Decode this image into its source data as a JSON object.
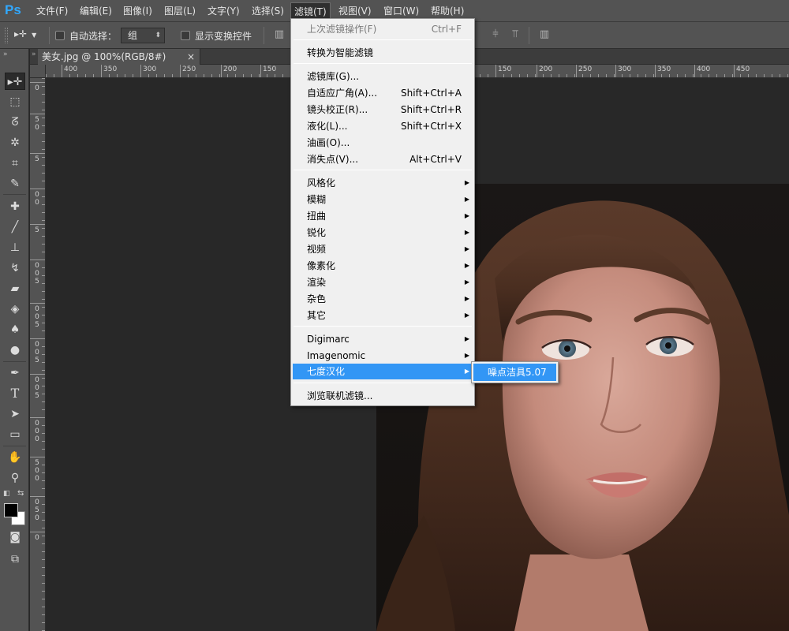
{
  "app": {
    "logo": "Ps"
  },
  "menubar": {
    "items": [
      "文件(F)",
      "编辑(E)",
      "图像(I)",
      "图层(L)",
      "文字(Y)",
      "选择(S)",
      "滤镜(T)",
      "视图(V)",
      "窗口(W)",
      "帮助(H)"
    ],
    "active": "滤镜(T)"
  },
  "options": {
    "auto_select_label": "自动选择：",
    "auto_select_checked": false,
    "group_select_value": "组",
    "show_transform_label": "显示变换控件",
    "show_transform_checked": false,
    "preset_icon": "move-tool-icon"
  },
  "document": {
    "tab_title": "美女.jpg @ 100%(RGB/8#)",
    "close_symbol": "×"
  },
  "ruler": {
    "h_labels": [
      "400",
      "350",
      "300",
      "250",
      "200",
      "150",
      "150",
      "200",
      "250",
      "300",
      "350",
      "400",
      "450"
    ],
    "v_labels": [
      "0",
      "5",
      "0",
      "5",
      "0",
      "0",
      "5",
      "0",
      "0",
      "5",
      "0",
      "0",
      "5",
      "0",
      "0",
      "5",
      "0",
      "0",
      "5",
      "0",
      "0",
      "0",
      "5",
      "0",
      "0",
      "0",
      "5",
      "0",
      "0"
    ]
  },
  "toolbar": {
    "tools": [
      "move-tool-icon",
      "marquee-tool-icon",
      "lasso-tool-icon",
      "magic-wand-icon",
      "crop-tool-icon",
      "eyedropper-icon",
      "healing-brush-icon",
      "brush-tool-icon",
      "clone-stamp-icon",
      "history-brush-icon",
      "eraser-icon",
      "paint-bucket-icon",
      "blur-tool-icon",
      "dodge-tool-icon",
      "pen-tool-icon",
      "type-tool-icon",
      "path-selection-icon",
      "shape-tool-icon",
      "hand-tool-icon",
      "zoom-tool-icon",
      "quick-mask-icon",
      "screen-mode-icon"
    ],
    "foreground_color": "#000000",
    "background_color": "#ffffff"
  },
  "filter_menu": {
    "last_filter": {
      "label": "上次滤镜操作(F)",
      "shortcut": "Ctrl+F",
      "disabled": true
    },
    "convert_smart": "转换为智能滤镜",
    "group2": [
      {
        "label": "滤镜库(G)...",
        "shortcut": ""
      },
      {
        "label": "自适应广角(A)...",
        "shortcut": "Shift+Ctrl+A"
      },
      {
        "label": "镜头校正(R)...",
        "shortcut": "Shift+Ctrl+R"
      },
      {
        "label": "液化(L)...",
        "shortcut": "Shift+Ctrl+X"
      },
      {
        "label": "油画(O)...",
        "shortcut": ""
      },
      {
        "label": "消失点(V)...",
        "shortcut": "Alt+Ctrl+V"
      }
    ],
    "group3": [
      "风格化",
      "模糊",
      "扭曲",
      "锐化",
      "视频",
      "像素化",
      "渲染",
      "杂色",
      "其它"
    ],
    "group4": [
      "Digimarc",
      "Imagenomic",
      "七度汉化"
    ],
    "highlighted": "七度汉化",
    "browse_online": "浏览联机滤镜...",
    "submenu_arrow": "▶"
  },
  "submenu": {
    "items": [
      "噪点洁具5.07"
    ]
  },
  "colors": {
    "menu_highlight": "#3296f5",
    "ui_panel": "#535353",
    "canvas": "#282828"
  }
}
